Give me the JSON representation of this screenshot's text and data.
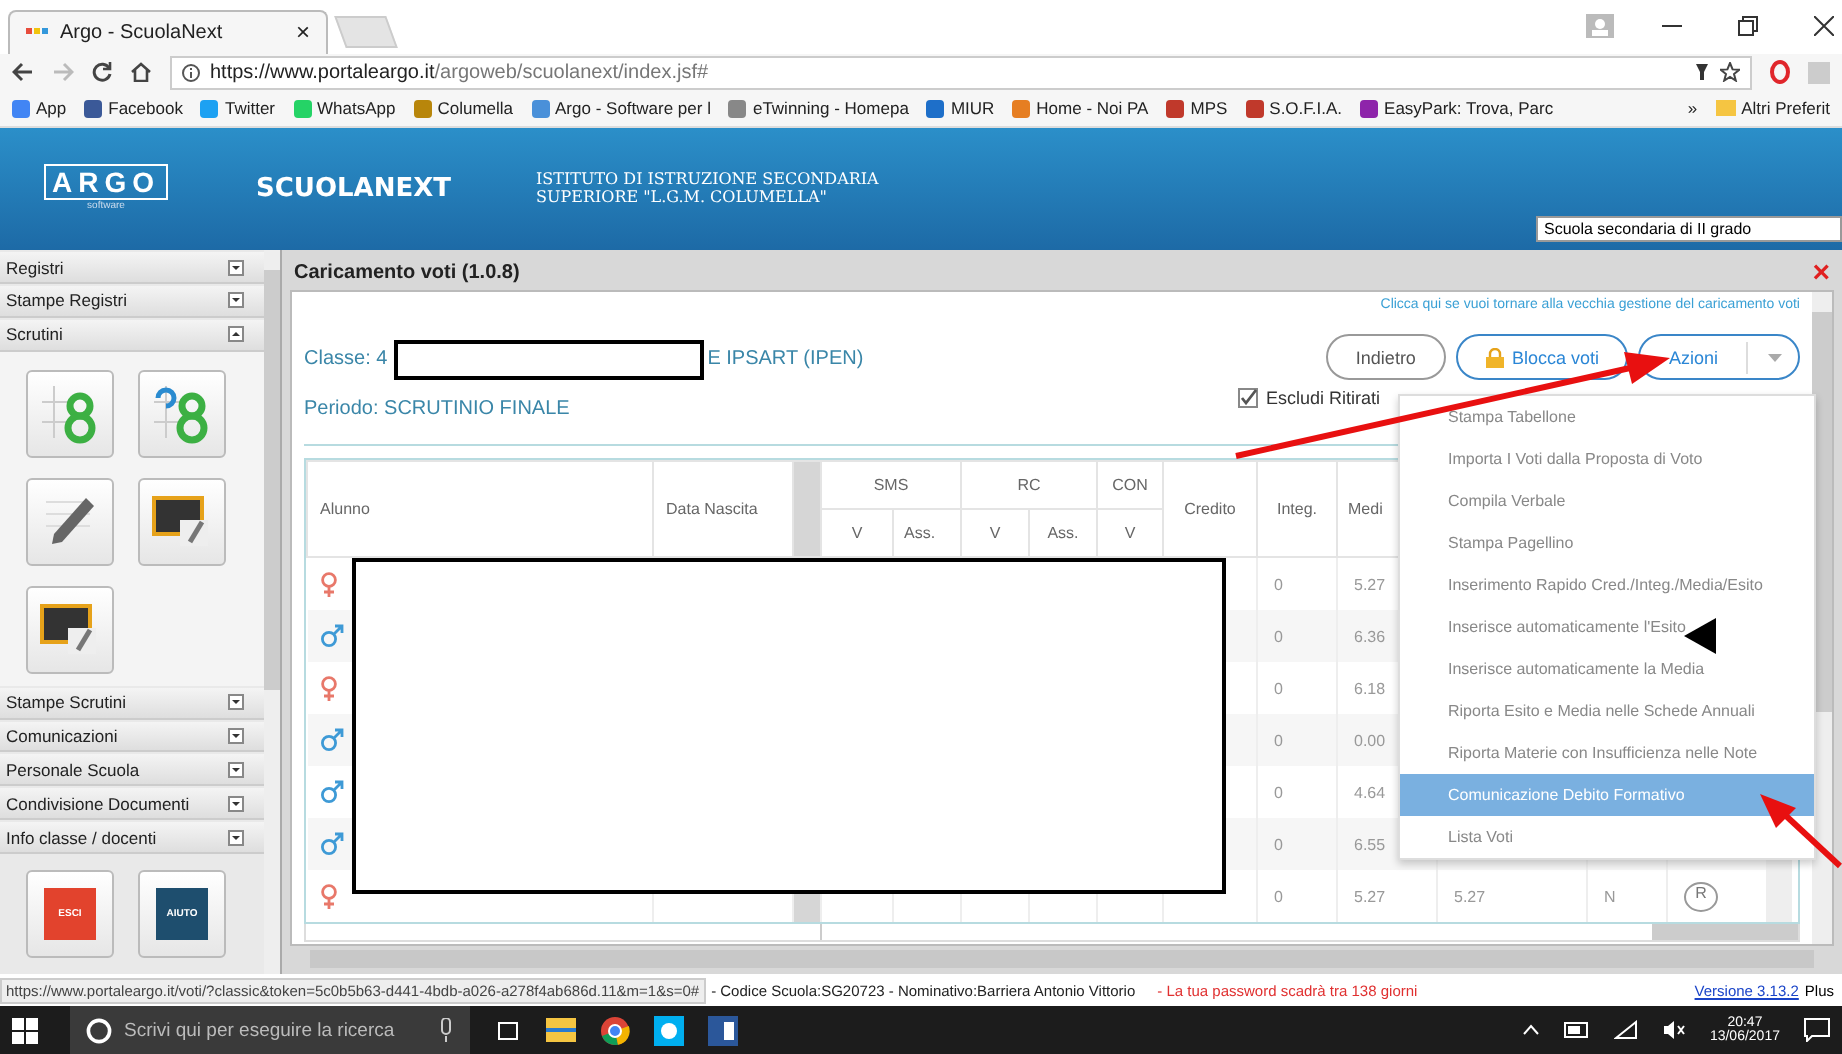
{
  "browser": {
    "tab_title": "Argo - ScuolaNext",
    "tab_close": "×",
    "url_host": "https://www.portaleargo.it",
    "url_path": "/argoweb/scuolanext/index.jsf#",
    "bookmarks": [
      "App",
      "Facebook",
      "Twitter",
      "WhatsApp",
      "Columella",
      "Argo - Software per l",
      "eTwinning - Homepa",
      "MIUR",
      "Home - Noi PA",
      "MPS",
      "S.O.F.I.A.",
      "EasyPark: Trova, Parc"
    ],
    "more": "»",
    "other_bookmarks": "Altri Preferit"
  },
  "header": {
    "logo": "ARGO",
    "logo_sub": "software",
    "product": "SCUOLANEXT",
    "school_line1": "ISTITUTO DI ISTRUZIONE SECONDARIA",
    "school_line2": "SUPERIORE \"L.G.M. COLUMELLA\"",
    "school_type": "Scuola secondaria di II grado"
  },
  "sidebar": {
    "sections": [
      {
        "label": "Registri",
        "expanded": false
      },
      {
        "label": "Stampe Registri",
        "expanded": false
      },
      {
        "label": "Scrutini",
        "expanded": true,
        "tiles": [
          {
            "kind": "grid8"
          },
          {
            "kind": "refresh8"
          },
          {
            "kind": "pencil"
          },
          {
            "kind": "board"
          },
          {
            "kind": "board"
          }
        ]
      },
      {
        "label": "Stampe Scrutini",
        "expanded": false
      },
      {
        "label": "Comunicazioni",
        "expanded": false
      },
      {
        "label": "Personale Scuola",
        "expanded": false
      },
      {
        "label": "Condivisione Documenti",
        "expanded": false
      },
      {
        "label": "Info classe / docenti",
        "expanded": false
      }
    ],
    "buttons": [
      {
        "label": "ESCI",
        "kind": "exit"
      },
      {
        "label": "AIUTO",
        "kind": "help"
      }
    ]
  },
  "panel": {
    "title": "Caricamento voti (1.0.8)",
    "close": "×",
    "old_link": "Clicca qui se vuoi tornare alla vecchia gestione del caricamento voti",
    "classe": "Classe: 4",
    "classe_rest": "E IPSART (IPEN)",
    "periodo": "Periodo: SCRUTINIO FINALE",
    "buttons": {
      "back": "Indietro",
      "lock": "Blocca voti",
      "actions": "Azioni"
    },
    "exclude_withdrawn": {
      "label": "Escludi Ritirati",
      "checked": true
    }
  },
  "table": {
    "columns_before": [
      "Alunno",
      "Data Nascita"
    ],
    "subject_groups": [
      {
        "label": "SMS",
        "subs": [
          "V",
          "Ass."
        ]
      },
      {
        "label": "RC",
        "subs": [
          "V",
          "Ass."
        ]
      },
      {
        "label": "CON",
        "subs": [
          "V"
        ]
      }
    ],
    "columns_after": [
      "Credito",
      "Integ.",
      "Medi"
    ],
    "rows": [
      {
        "kind": "female",
        "integ": "0",
        "media": "5.27"
      },
      {
        "kind": "male",
        "integ": "0",
        "media": "6.36"
      },
      {
        "kind": "female",
        "integ": "0",
        "media": "6.18"
      },
      {
        "kind": "male",
        "integ": "0",
        "media": "0.00"
      },
      {
        "kind": "male",
        "integ": "0",
        "media": "4.64"
      },
      {
        "kind": "male",
        "integ": "0",
        "media": "6.55"
      },
      {
        "kind": "female",
        "integ": "0",
        "media": "5.27",
        "extra": [
          "5.27",
          "N",
          "R"
        ]
      }
    ]
  },
  "actions_menu": [
    {
      "label": "Stampa Tabellone",
      "selected": false
    },
    {
      "label": "Importa I Voti dalla Proposta di Voto",
      "selected": false
    },
    {
      "label": "Compila Verbale",
      "selected": false
    },
    {
      "label": "Stampa Pagellino",
      "selected": false
    },
    {
      "label": "Inserimento Rapido Cred./Integ./Media/Esito",
      "selected": false
    },
    {
      "label": "Inserisce automaticamente l'Esito",
      "selected": false
    },
    {
      "label": "Inserisce automaticamente la Media",
      "selected": false
    },
    {
      "label": "Riporta Esito e Media nelle Schede Annuali",
      "selected": false
    },
    {
      "label": "Riporta Materie con Insufficienza nelle Note",
      "selected": false
    },
    {
      "label": "Comunicazione Debito Formativo",
      "selected": true
    },
    {
      "label": "Lista Voti",
      "selected": false
    }
  ],
  "status_bar": {
    "url": "https://www.portaleargo.it/voti/?classic&token=5c0b5b63-d441-4bdb-a026-a278f4ab686d.11&m=1&s=0#",
    "info": "- Codice Scuola:SG20723 - Nominativo:Barriera Antonio Vittorio",
    "warning": "- La tua password scadrà tra 138 giorni",
    "version": "Versione 3.13.2",
    "edition": "Plus"
  },
  "taskbar": {
    "search_placeholder": "Scrivi qui per eseguire la ricerca",
    "time": "20:47",
    "date": "13/06/2017"
  }
}
